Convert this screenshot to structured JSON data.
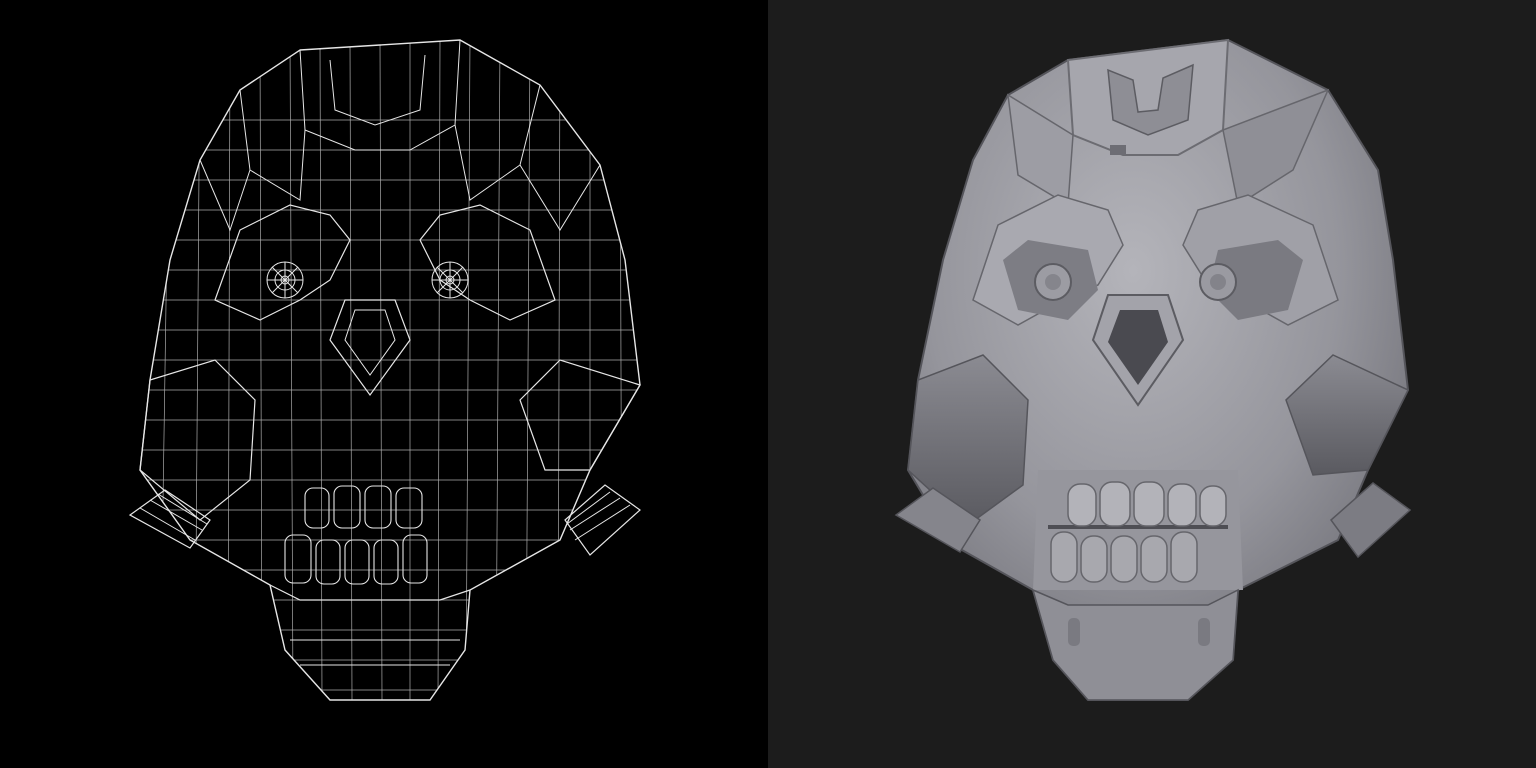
{
  "panels": [
    {
      "id": "wireframe",
      "view": "wireframe",
      "subject": "mechanical-skull-mesh",
      "background": "#000000",
      "line_color": "#e6e6e6"
    },
    {
      "id": "render",
      "view": "clay-render",
      "subject": "mechanical-skull-sculpt",
      "background": "#1c1c1c",
      "surface_color": "#9a9aa0"
    }
  ]
}
